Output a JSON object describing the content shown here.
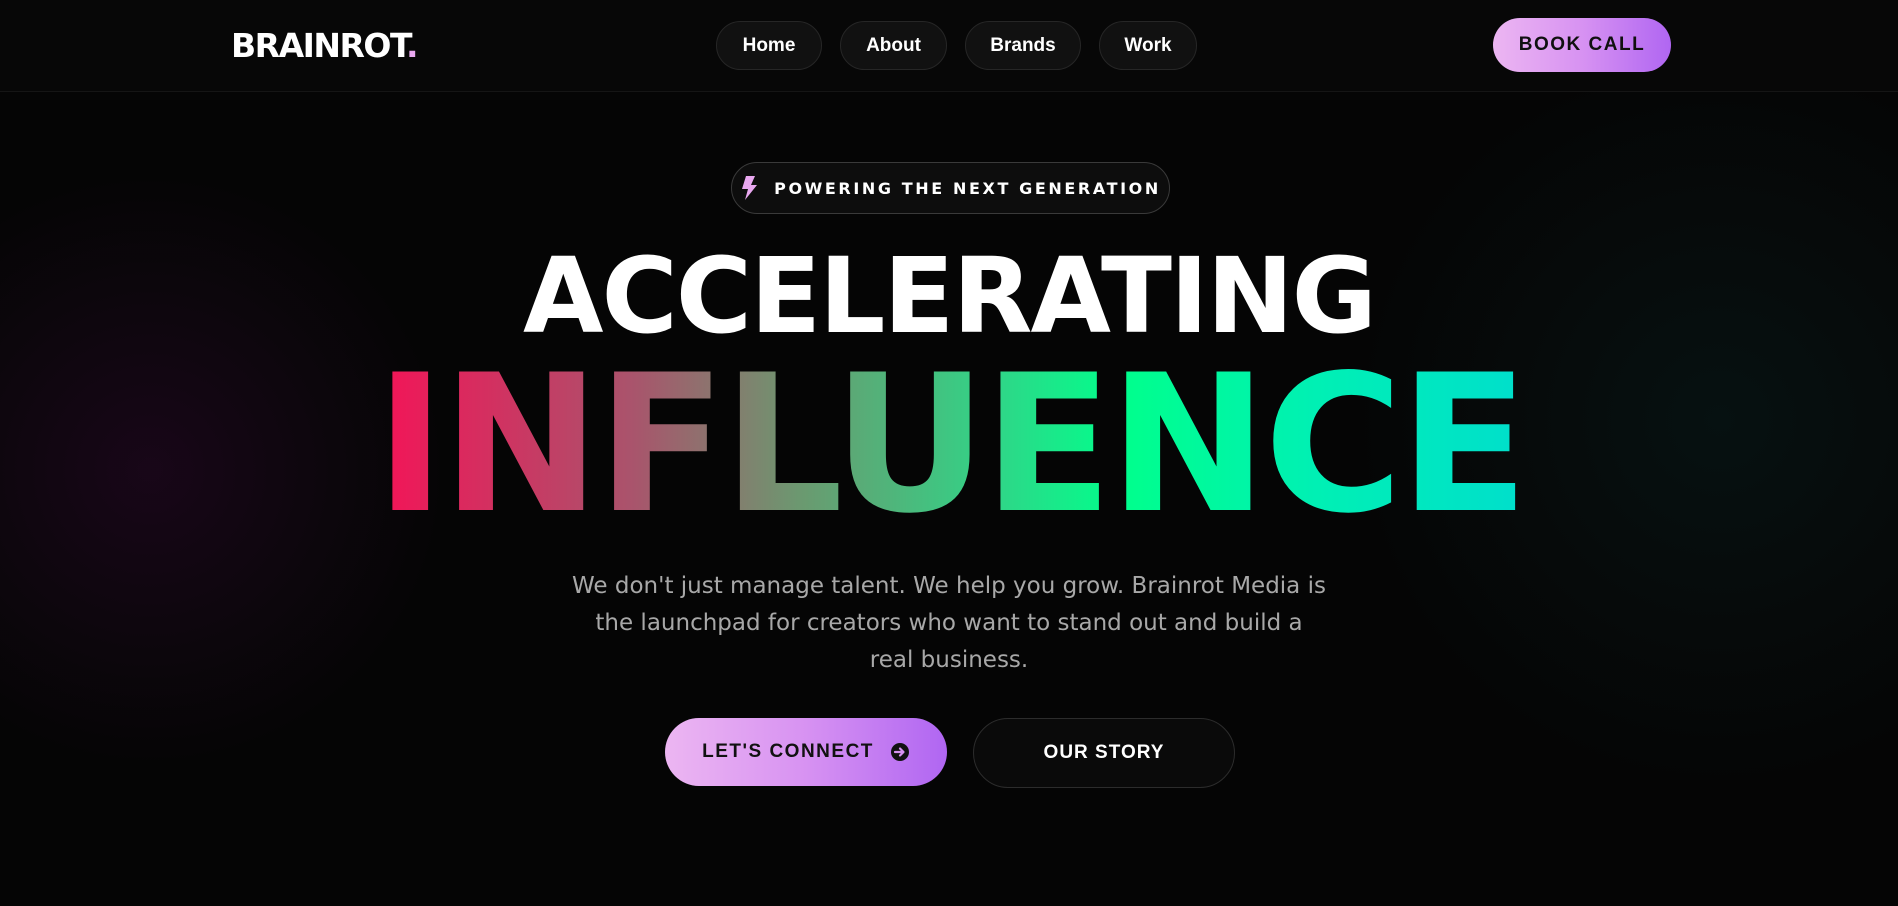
{
  "brand": {
    "name": "BRAINROT",
    "dot": "."
  },
  "nav": {
    "items": [
      {
        "label": "Home"
      },
      {
        "label": "About"
      },
      {
        "label": "Brands"
      },
      {
        "label": "Work"
      }
    ],
    "cta_label": "BOOK CALL"
  },
  "hero": {
    "badge_icon": "lightning-bolt-icon",
    "badge_text": "POWERING THE NEXT GENERATION",
    "headline_line1": "ACCELERATING",
    "headline_line2": "INFLUENCE",
    "lead_line1": "We don't just manage talent. We help you grow. Brainrot Media is",
    "lead_line2": "the launchpad for creators who want to stand out and build a",
    "lead_line3": "real business.",
    "primary_cta_label": "LET'S CONNECT",
    "primary_cta_icon": "arrow-circle-right-icon",
    "secondary_cta_label": "OUR STORY"
  },
  "colors": {
    "background": "#050505",
    "accent_pink": "#ecb6f2",
    "accent_purple": "#b066f2",
    "gradient_start": "#ff0a54",
    "gradient_mid": "#00ff8c",
    "gradient_end": "#00dcd0"
  }
}
